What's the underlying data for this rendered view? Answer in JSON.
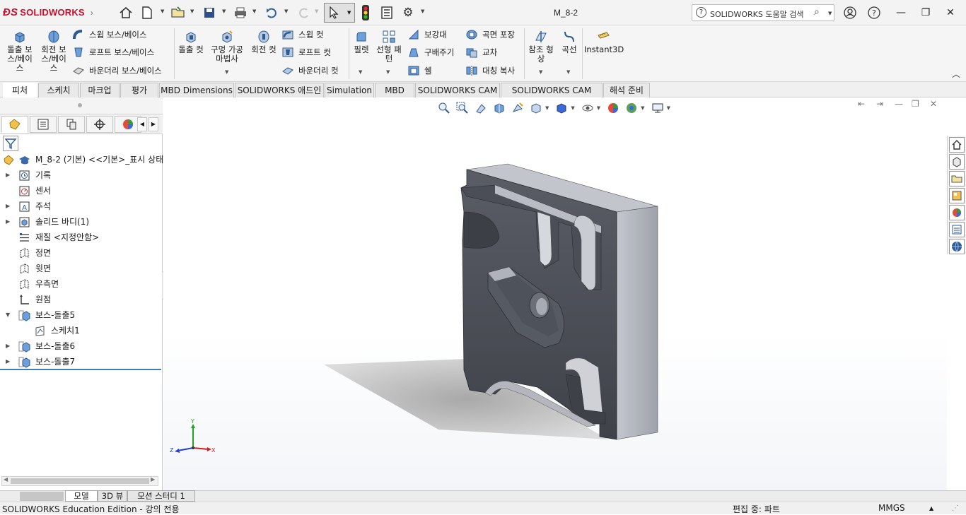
{
  "app": {
    "logo_text": "SOLIDWORKS",
    "document_title": "M_8-2",
    "search_placeholder": "SOLIDWORKS 도움말 검색"
  },
  "ribbon": {
    "extrude_boss": "돌출 보스/베이스",
    "revolve_boss": "회전 보스/베이스",
    "sweep_boss": "스윕 보스/베이스",
    "loft_boss": "로프트 보스/베이스",
    "boundary_boss": "바운더리 보스/베이스",
    "extrude_cut": "돌출 컷",
    "hole_wizard": "구멍 가공 마법사",
    "revolve_cut": "회전 컷",
    "sweep_cut": "스윕 컷",
    "loft_cut": "로프트 컷",
    "boundary_cut": "바운더리 컷",
    "fillet": "필렛",
    "linear_pattern": "선형 패턴",
    "rib": "보강대",
    "draft": "구배주기",
    "shell": "쉘",
    "wrap": "곡면 포장",
    "intersect": "교차",
    "mirror": "대칭 복사",
    "reference_geometry": "참조 형상",
    "curves": "곡선",
    "instant3d": "Instant3D"
  },
  "tabs": [
    {
      "label": "피처",
      "active": true
    },
    {
      "label": "스케치",
      "active": false
    },
    {
      "label": "마크업",
      "active": false
    },
    {
      "label": "평가",
      "active": false
    },
    {
      "label": "MBD Dimensions",
      "active": false
    },
    {
      "label": "SOLIDWORKS 애드인",
      "active": false
    },
    {
      "label": "Simulation",
      "active": false
    },
    {
      "label": "MBD",
      "active": false
    },
    {
      "label": "SOLIDWORKS CAM",
      "active": false
    },
    {
      "label": "SOLIDWORKS CAM TBM",
      "active": false
    },
    {
      "label": "해석 준비",
      "active": false
    }
  ],
  "tree": {
    "root": "M_8-2 (기본) <<기본>_표시 상태",
    "items": [
      {
        "label": "기록",
        "icon": "history-icon",
        "expandable": true
      },
      {
        "label": "센서",
        "icon": "sensor-icon",
        "expandable": false
      },
      {
        "label": "주석",
        "icon": "annotation-icon",
        "expandable": true
      },
      {
        "label": "솔리드 바디(1)",
        "icon": "solid-body-icon",
        "expandable": true
      },
      {
        "label": "재질 <지정안함>",
        "icon": "material-icon",
        "expandable": false
      },
      {
        "label": "정면",
        "icon": "plane-icon",
        "expandable": false
      },
      {
        "label": "윗면",
        "icon": "plane-icon",
        "expandable": false
      },
      {
        "label": "우측면",
        "icon": "plane-icon",
        "expandable": false
      },
      {
        "label": "원점",
        "icon": "origin-icon",
        "expandable": false
      },
      {
        "label": "보스-돌출5",
        "icon": "extrude-feature-icon",
        "expandable": true,
        "expanded": true
      },
      {
        "label": "스케치1",
        "icon": "sketch-icon",
        "expandable": false,
        "child": true
      },
      {
        "label": "보스-돌출6",
        "icon": "extrude-feature-icon",
        "expandable": true
      },
      {
        "label": "보스-돌출7",
        "icon": "extrude-feature-icon",
        "expandable": true
      }
    ]
  },
  "triad": {
    "x": "X",
    "y": "Y",
    "z": "Z"
  },
  "bottom_tabs": [
    {
      "label": "모델",
      "active": true
    },
    {
      "label": "3D 뷰",
      "active": false
    },
    {
      "label": "모션 스터디 1",
      "active": false
    }
  ],
  "status": {
    "edition": "SOLIDWORKS Education Edition - 강의 전용",
    "mode": "편집 중: 파트",
    "units": "MMGS"
  },
  "colors": {
    "brand_red": "#c8102e",
    "accent_blue": "#3b7ec2",
    "part_face_dark": "#4b4e57",
    "part_face_light": "#b9bcc4"
  }
}
